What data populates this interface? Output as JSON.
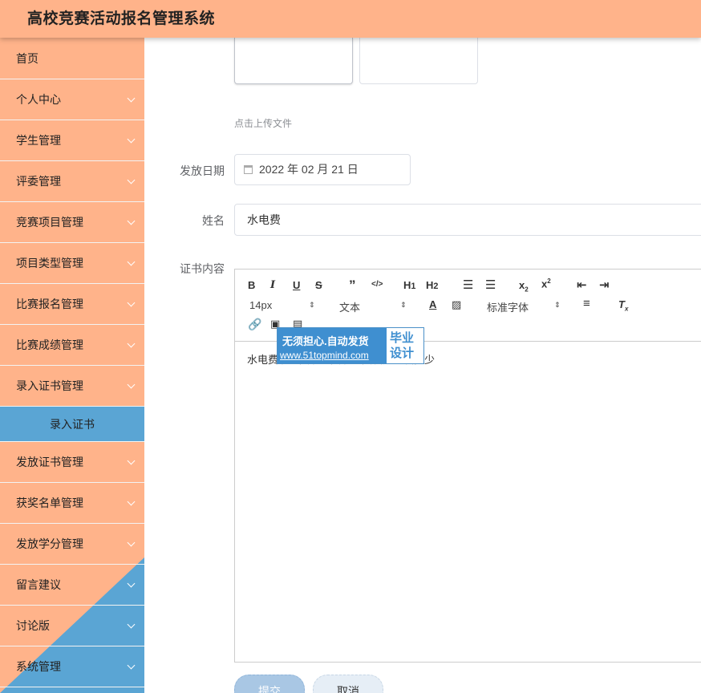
{
  "app": {
    "title": "高校竞赛活动报名管理系统"
  },
  "sidebar": {
    "items": [
      {
        "label": "首页"
      },
      {
        "label": "个人中心"
      },
      {
        "label": "学生管理"
      },
      {
        "label": "评委管理"
      },
      {
        "label": "竞赛项目管理"
      },
      {
        "label": "项目类型管理"
      },
      {
        "label": "比赛报名管理"
      },
      {
        "label": "比赛成绩管理"
      },
      {
        "label": "录入证书管理"
      }
    ],
    "active_sub_item": "录入证书",
    "items_after": [
      {
        "label": "发放证书管理"
      },
      {
        "label": "获奖名单管理"
      },
      {
        "label": "发放学分管理"
      },
      {
        "label": "留言建议"
      },
      {
        "label": "讨论版"
      },
      {
        "label": "系统管理"
      }
    ],
    "colors": {
      "primary": "#ffb38a",
      "accent": "#5aa5d4"
    }
  },
  "form": {
    "upload_hint": "点击上传文件",
    "issue_date": {
      "label": "发放日期",
      "value": "2022 年 02 月 21 日"
    },
    "name": {
      "label": "姓名",
      "value": "水电费"
    },
    "certificate_content": {
      "label": "证书内容"
    }
  },
  "editor": {
    "font_size": "14px",
    "paragraph": "文本",
    "font_family": "标准字体",
    "content": "水电费水电费水电费水电费发送到发多少"
  },
  "watermark": {
    "line1": "无须担心.自动发货",
    "line2": "www.51topmind.com",
    "right": "毕业设计"
  },
  "actions": {
    "submit": "提交",
    "cancel": "取消"
  }
}
